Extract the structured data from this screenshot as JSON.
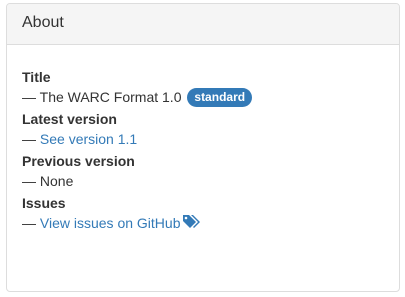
{
  "panel": {
    "heading": "About"
  },
  "about": {
    "dash": "—",
    "title": {
      "label": "Title",
      "value": "The WARC Format 1.0",
      "badge": "standard"
    },
    "latest_version": {
      "label": "Latest version",
      "link": "See version 1.1"
    },
    "previous_version": {
      "label": "Previous version",
      "value": "None"
    },
    "issues": {
      "label": "Issues",
      "link": "View issues on GitHub",
      "icon": "tags-icon"
    }
  },
  "colors": {
    "link": "#337ab7",
    "badge": "#337ab7",
    "heading_bg": "#f5f5f5"
  }
}
